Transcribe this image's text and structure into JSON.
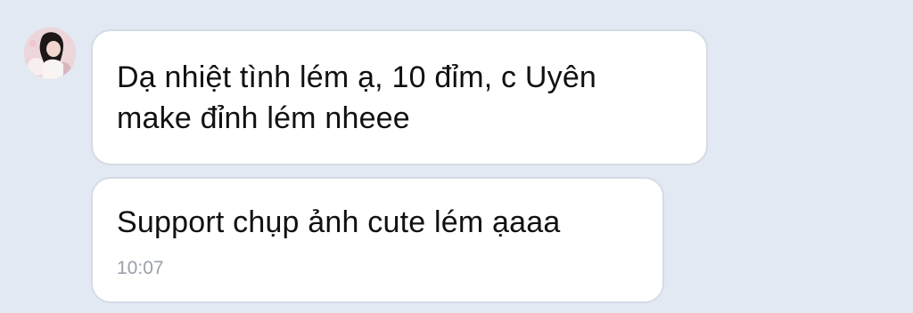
{
  "conversation": {
    "messages": [
      {
        "text": "Dạ nhiệt tình lém ạ, 10 đỉm, c Uyên\nmake đỉnh lém nheee",
        "time": ""
      },
      {
        "text": "Support chụp ảnh cute lém ạaaa",
        "time": "10:07"
      }
    ]
  },
  "colors": {
    "background": "#e3e9f2",
    "bubble": "#ffffff",
    "bubble_border": "#d5dbe5",
    "text": "#111111",
    "timestamp": "#9aa1ab"
  }
}
